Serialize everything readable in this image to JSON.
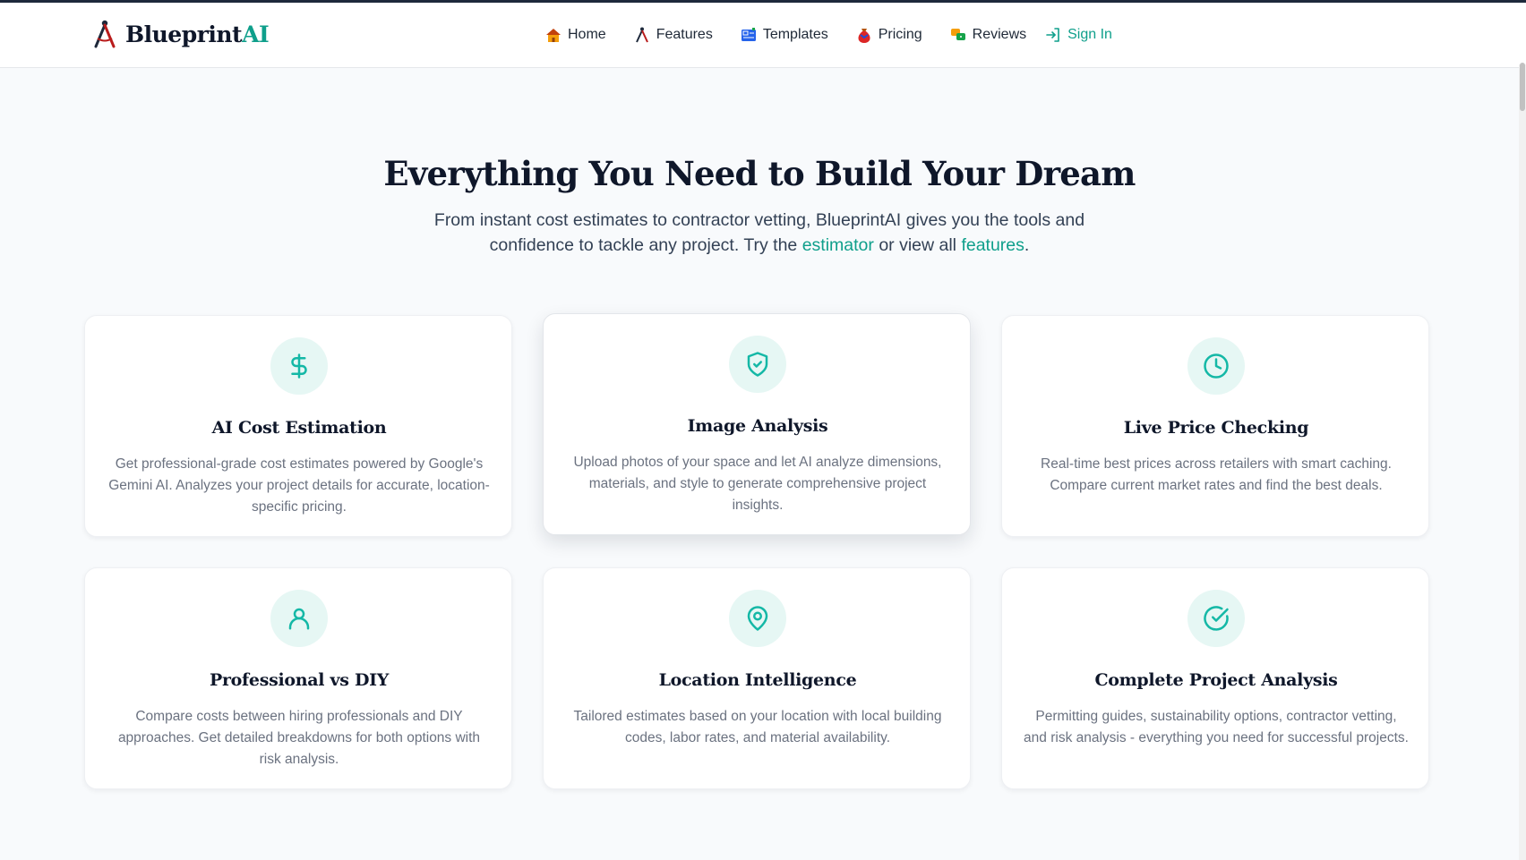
{
  "brand": {
    "name_main": "Blueprint",
    "name_accent": "AI"
  },
  "nav": {
    "items": [
      {
        "label": "Home",
        "icon": "house-emoji-icon"
      },
      {
        "label": "Features",
        "icon": "compass-icon"
      },
      {
        "label": "Templates",
        "icon": "blueprint-emoji-icon"
      },
      {
        "label": "Pricing",
        "icon": "money-bag-emoji-icon"
      },
      {
        "label": "Reviews",
        "icon": "speech-bubbles-emoji-icon"
      }
    ],
    "signin_label": "Sign In"
  },
  "hero": {
    "heading": "Everything You Need to Build Your Dream",
    "subtitle_part1": "From instant cost estimates to contractor vetting, BlueprintAI gives you the tools and confidence to tackle any project. Try the ",
    "link_estimator": "estimator",
    "subtitle_part2": " or view all ",
    "link_features": "features",
    "subtitle_part3": "."
  },
  "features": [
    {
      "title": "AI Cost Estimation",
      "icon": "dollar-icon",
      "description": "Get professional-grade cost estimates powered by Google's Gemini AI. Analyzes your project details for accurate, location-specific pricing."
    },
    {
      "title": "Image Analysis",
      "icon": "shield-check-icon",
      "description": "Upload photos of your space and let AI analyze dimensions, materials, and style to generate comprehensive project insights."
    },
    {
      "title": "Live Price Checking",
      "icon": "clock-icon",
      "description": "Real-time best prices across retailers with smart caching. Compare current market rates and find the best deals."
    },
    {
      "title": "Professional vs DIY",
      "icon": "user-icon",
      "description": "Compare costs between hiring professionals and DIY approaches. Get detailed breakdowns for both options with risk analysis."
    },
    {
      "title": "Location Intelligence",
      "icon": "map-pin-icon",
      "description": "Tailored estimates based on your location with local building codes, labor rates, and material availability."
    },
    {
      "title": "Complete Project Analysis",
      "icon": "check-circle-icon",
      "description": "Permitting guides, sustainability options, contractor vetting, and risk analysis - everything you need for successful projects."
    }
  ],
  "colors": {
    "accent": "#0f9f8b",
    "icon_bg": "#e6f7f4",
    "heading": "#0f172a",
    "body_text": "#6b7280"
  }
}
